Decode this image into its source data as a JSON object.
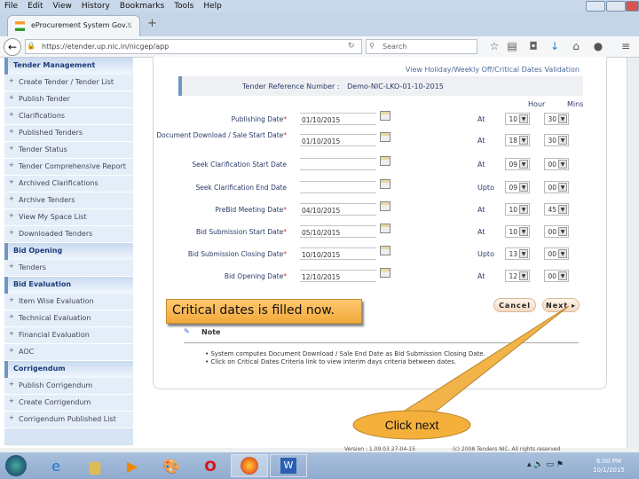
{
  "browser": {
    "menu": [
      "File",
      "Edit",
      "View",
      "History",
      "Bookmarks",
      "Tools",
      "Help"
    ],
    "tab_title": "eProcurement System Gov...",
    "url": "https://etender.up.nic.in/nicgep/app",
    "search_placeholder": "Search"
  },
  "sidebar": [
    {
      "heading": "Tender Management",
      "items": [
        "Create Tender / Tender List",
        "Publish Tender",
        "Clarifications",
        "Published Tenders",
        "Tender Status",
        "Tender Comprehensive Report",
        "Archived Clarifications",
        "Archive Tenders",
        "View My Space List",
        "Downloaded Tenders"
      ]
    },
    {
      "heading": "Bid Opening",
      "items": [
        "Tenders"
      ]
    },
    {
      "heading": "Bid Evaluation",
      "items": [
        "Item Wise Evaluation",
        "Technical Evaluation",
        "Financial Evaluation",
        "AOC"
      ]
    },
    {
      "heading": "Corrigendum",
      "items": [
        "Publish Corrigendum",
        "Create Corrigendum",
        "Corrigendum Published List"
      ]
    }
  ],
  "main": {
    "view_link": "View Holiday/Weekly Off/Critical Dates Validation",
    "ref_label": "Tender Reference Number :",
    "ref_value": "Demo-NIC-LKO-01-10-2015",
    "hour_header": "Hour",
    "mins_header": "Mins",
    "rows": [
      {
        "label": "Publishing Date",
        "required": true,
        "date": "01/10/2015",
        "prep": "At",
        "hour": "10",
        "mins": "30"
      },
      {
        "label": "Document Download / Sale Start Date",
        "required": true,
        "date": "01/10/2015",
        "prep": "At",
        "hour": "18",
        "mins": "30"
      },
      {
        "label": "Seek Clarification Start Date",
        "required": false,
        "date": "",
        "prep": "At",
        "hour": "09",
        "mins": "00"
      },
      {
        "label": "Seek Clarification End Date",
        "required": false,
        "date": "",
        "prep": "Upto",
        "hour": "09",
        "mins": "00"
      },
      {
        "label": "PreBid Meeting Date",
        "required": true,
        "date": "04/10/2015",
        "prep": "At",
        "hour": "10",
        "mins": "45"
      },
      {
        "label": "Bid Submission Start Date",
        "required": true,
        "date": "05/10/2015",
        "prep": "At",
        "hour": "10",
        "mins": "00"
      },
      {
        "label": "Bid Submission Closing Date",
        "required": true,
        "date": "10/10/2015",
        "prep": "Upto",
        "hour": "13",
        "mins": "00"
      },
      {
        "label": "Bid Opening Date",
        "required": true,
        "date": "12/10/2015",
        "prep": "At",
        "hour": "12",
        "mins": "00"
      }
    ],
    "cancel_label": "Cancel",
    "next_label": "Next ▸",
    "note_title": "Note",
    "notes": [
      "System computes Document Download / Sale End Date as Bid Submission Closing Date.",
      "Click on Critical Dates Criteria link to view interim days criteria between dates."
    ]
  },
  "callouts": {
    "status": "Critical dates is filled now.",
    "hint": "Click next"
  },
  "footer": {
    "version": "Version : 1.09.03 27-04-15",
    "copyright": "(c) 2008 Tenders NIC. All rights reserved"
  },
  "taskbar": {
    "time": "6:00 PM",
    "date": "10/1/2015"
  },
  "colors": {
    "accent": "#6f97c2",
    "callout": "#f2a93a"
  }
}
